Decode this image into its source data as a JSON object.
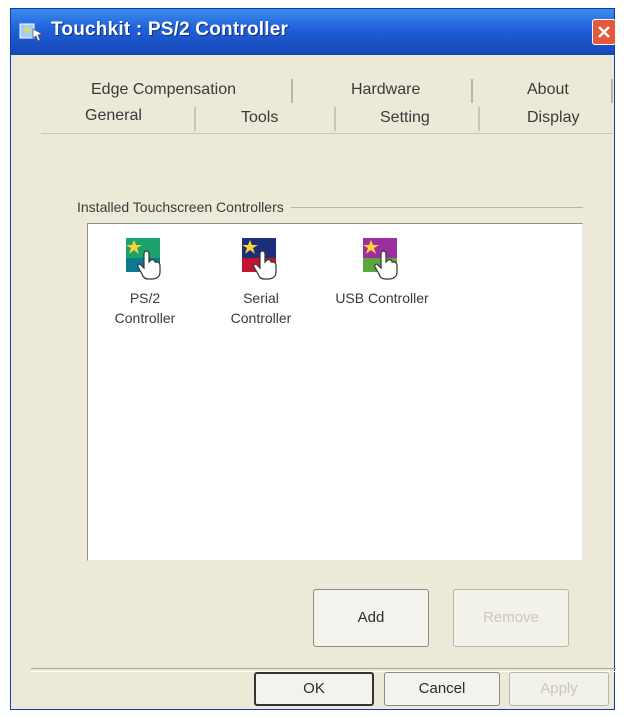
{
  "window": {
    "title": "Touchkit : PS/2 Controller"
  },
  "tabs": {
    "row_back": [
      "Edge Compensation",
      "Hardware",
      "About"
    ],
    "row_front": [
      "General",
      "Tools",
      "Setting",
      "Display"
    ],
    "selected": "General"
  },
  "general": {
    "group_label": "Installed Touchscreen Controllers",
    "controllers": [
      {
        "label_line1": "PS/2",
        "label_line2": "Controller",
        "icon": "ps2-touch-icon",
        "color": "#1aa36b"
      },
      {
        "label_line1": "Serial",
        "label_line2": "Controller",
        "icon": "serial-touch-icon",
        "color": "#c2132f"
      },
      {
        "label_line1": "USB Controller",
        "label_line2": "",
        "icon": "usb-touch-icon",
        "color": "#9b2fa0"
      }
    ],
    "add_label": "Add",
    "remove_label": "Remove"
  },
  "footer": {
    "ok_label": "OK",
    "cancel_label": "Cancel",
    "apply_label": "Apply"
  },
  "colors": {
    "titlebar": "#1f5fd8",
    "window_bg": "#ece9d8",
    "close": "#e4593b"
  }
}
